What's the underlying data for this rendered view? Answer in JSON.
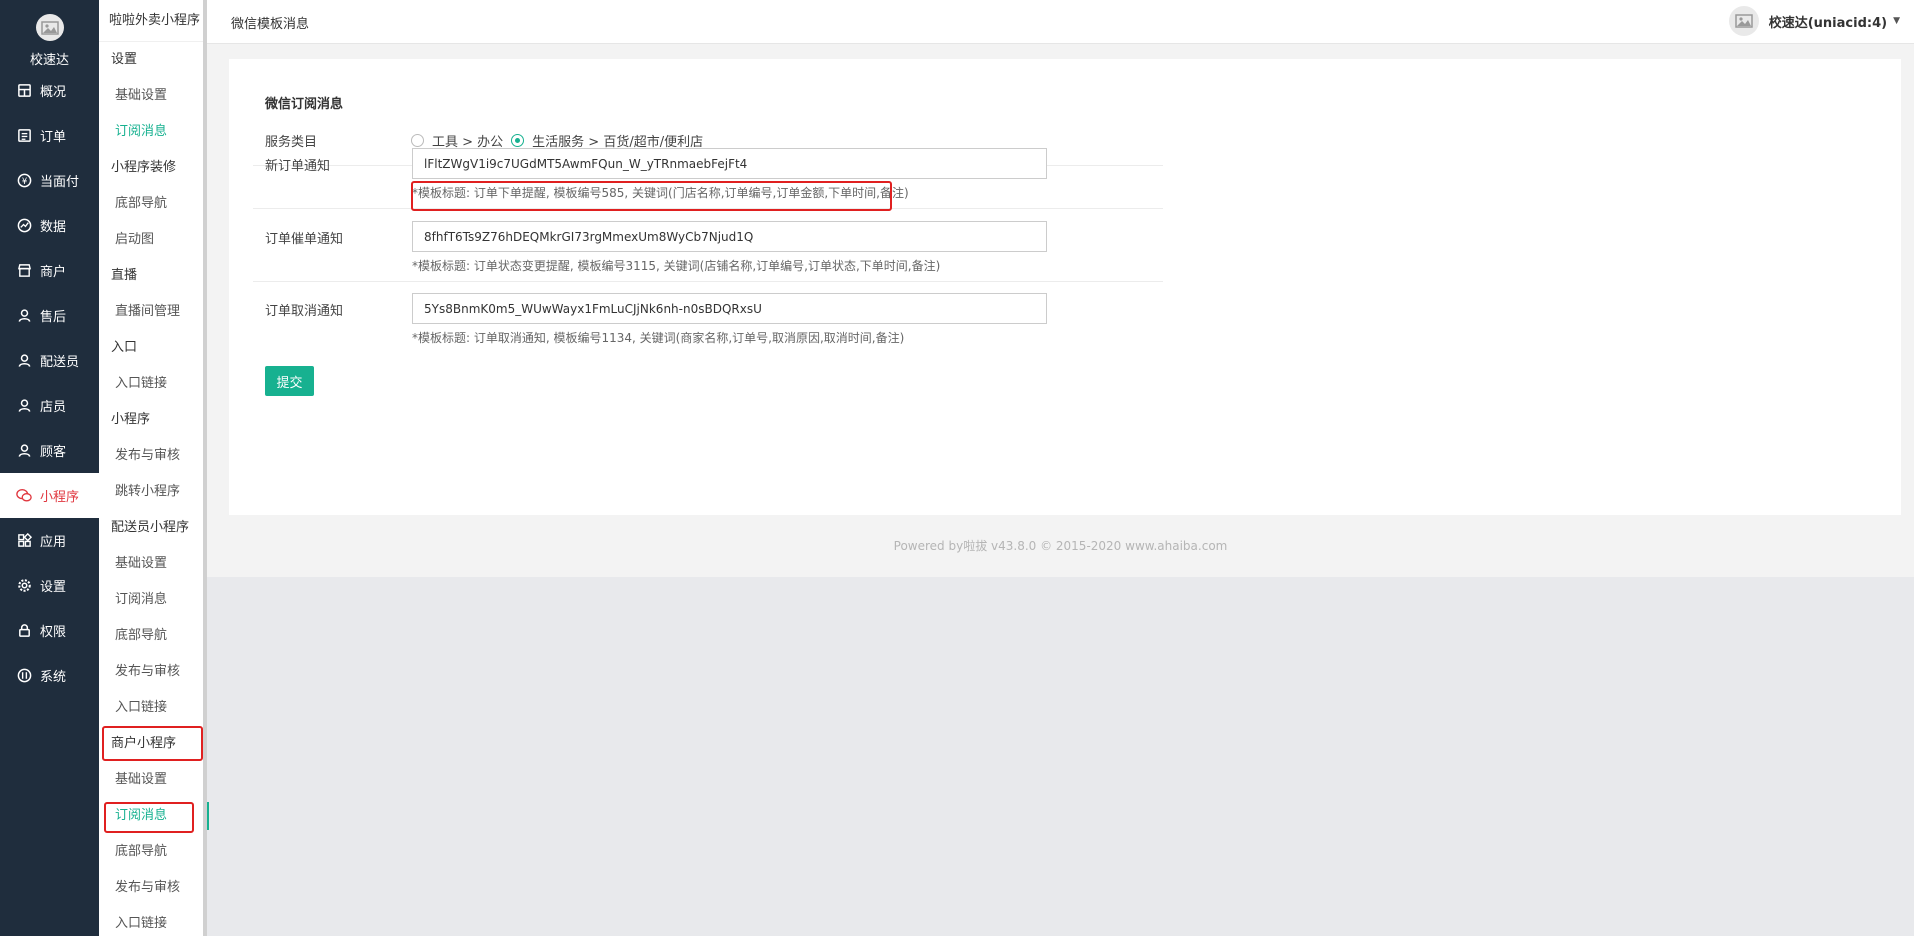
{
  "brand": {
    "name": "校速达"
  },
  "nav": [
    {
      "key": "overview",
      "label": "概况",
      "icon": "dashboard-icon"
    },
    {
      "key": "orders",
      "label": "订单",
      "icon": "list-icon"
    },
    {
      "key": "pay",
      "label": "当面付",
      "icon": "yuan-icon"
    },
    {
      "key": "data",
      "label": "数据",
      "icon": "chart-icon"
    },
    {
      "key": "merchant",
      "label": "商户",
      "icon": "store-icon"
    },
    {
      "key": "aftersale",
      "label": "售后",
      "icon": "user-icon"
    },
    {
      "key": "courier",
      "label": "配送员",
      "icon": "user-icon"
    },
    {
      "key": "clerk",
      "label": "店员",
      "icon": "user-icon"
    },
    {
      "key": "customer",
      "label": "顾客",
      "icon": "user-icon"
    },
    {
      "key": "miniapp",
      "label": "小程序",
      "icon": "wechat-icon",
      "active": true
    },
    {
      "key": "apps",
      "label": "应用",
      "icon": "apps-icon"
    },
    {
      "key": "settings",
      "label": "设置",
      "icon": "gear-icon"
    },
    {
      "key": "permission",
      "label": "权限",
      "icon": "lock-icon"
    },
    {
      "key": "system",
      "label": "系统",
      "icon": "system-icon"
    }
  ],
  "subnav": {
    "title": "啦啦外卖小程序",
    "groups": [
      {
        "label": "设置"
      },
      {
        "item": "基础设置"
      },
      {
        "item": "订阅消息",
        "active": true
      },
      {
        "label": "小程序装修"
      },
      {
        "item": "底部导航"
      },
      {
        "item": "启动图"
      },
      {
        "label": "直播"
      },
      {
        "item": "直播间管理"
      },
      {
        "label": "入口"
      },
      {
        "item": "入口链接"
      },
      {
        "label": "小程序"
      },
      {
        "item": "发布与审核"
      },
      {
        "item": "跳转小程序"
      },
      {
        "label": "配送员小程序"
      },
      {
        "item": "基础设置"
      },
      {
        "item": "订阅消息"
      },
      {
        "item": "底部导航"
      },
      {
        "item": "发布与审核"
      },
      {
        "item": "入口链接"
      },
      {
        "label": "商户小程序"
      },
      {
        "item": "基础设置"
      },
      {
        "item": "订阅消息",
        "active": true
      },
      {
        "item": "底部导航"
      },
      {
        "item": "发布与审核"
      },
      {
        "item": "入口链接"
      }
    ]
  },
  "header": {
    "breadcrumb": "微信模板消息",
    "user": "校速达(uniacid:4)"
  },
  "form": {
    "title": "微信订阅消息",
    "service_label": "服务类目",
    "service_options": [
      {
        "label": "工具 > 办公",
        "checked": false
      },
      {
        "label": "生活服务 > 百货/超市/便利店",
        "checked": true
      }
    ],
    "fields": [
      {
        "label": "新订单通知",
        "value": "lFltZWgV1i9c7UGdMT5AwmFQun_W_yTRnmaebFejFt4",
        "help": "*模板标题: 订单下单提醒, 模板编号585, 关键词(门店名称,订单编号,订单金额,下单时间,备注)"
      },
      {
        "label": "订单催单通知",
        "value": "8fhfT6Ts9Z76hDEQMkrGI73rgMmexUm8WyCb7Njud1Q",
        "help": "*模板标题: 订单状态变更提醒, 模板编号3115, 关键词(店铺名称,订单编号,订单状态,下单时间,备注)"
      },
      {
        "label": "订单取消通知",
        "value": "5Ys8BnmK0m5_WUwWayx1FmLuCJjNk6nh-n0sBDQRxsU",
        "help": "*模板标题: 订单取消通知, 模板编号1134, 关键词(商家名称,订单号,取消原因,取消时间,备注)"
      }
    ],
    "submit_label": "提交"
  },
  "footer": "Powered by啦拔 v43.8.0 © 2015-2020 www.ahaiba.com",
  "colors": {
    "accent": "#17b190",
    "nav_bg": "#1f2d3d",
    "active_nav": "#e0373f",
    "annotation": "#e02020"
  }
}
